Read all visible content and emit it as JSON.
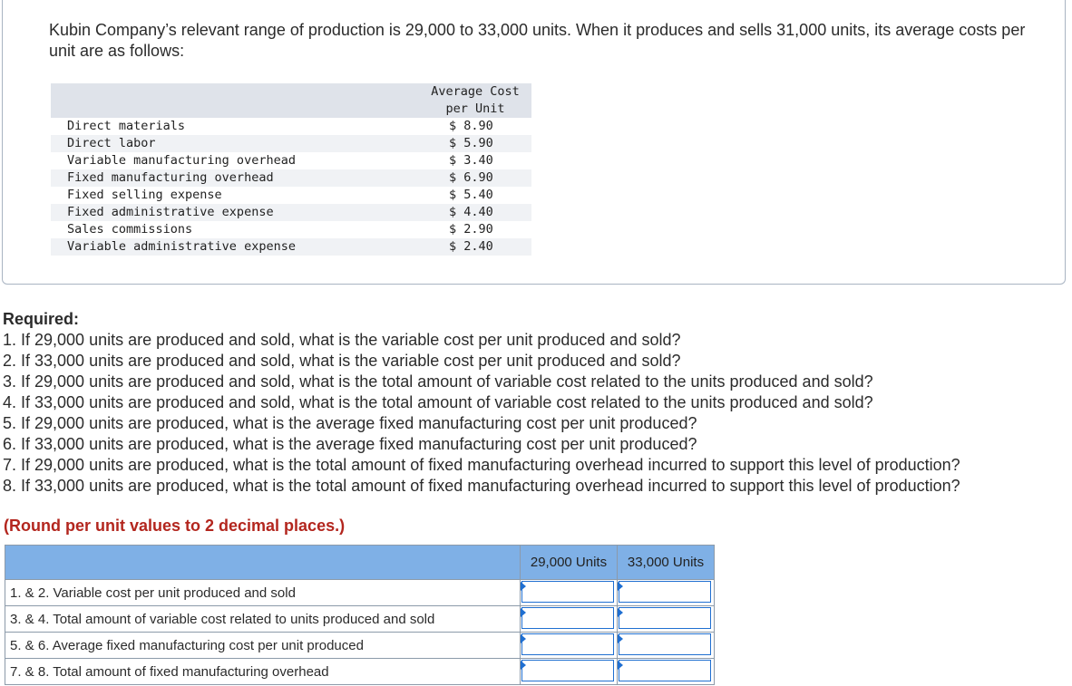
{
  "intro": "Kubin Company’s relevant range of production is 29,000 to 33,000 units. When it produces and sells 31,000 units, its average costs per unit are as follows:",
  "cost_table": {
    "header_line1": "Average Cost",
    "header_line2": "per Unit",
    "rows": [
      {
        "label": "Direct materials",
        "value": "$ 8.90"
      },
      {
        "label": "Direct labor",
        "value": "$ 5.90"
      },
      {
        "label": "Variable manufacturing overhead",
        "value": "$ 3.40"
      },
      {
        "label": "Fixed manufacturing overhead",
        "value": "$ 6.90"
      },
      {
        "label": "Fixed selling expense",
        "value": "$ 5.40"
      },
      {
        "label": "Fixed administrative expense",
        "value": "$ 4.40"
      },
      {
        "label": "Sales commissions",
        "value": "$ 2.90"
      },
      {
        "label": "Variable administrative expense",
        "value": "$ 2.40"
      }
    ]
  },
  "required": {
    "heading": "Required:",
    "items": [
      "1. If 29,000 units are produced and sold, what is the variable cost per unit produced and sold?",
      "2. If 33,000 units are produced and sold, what is the variable cost per unit produced and sold?",
      "3. If 29,000 units are produced and sold, what is the total amount of variable cost related to the units produced and sold?",
      "4. If 33,000 units are produced and sold, what is the total amount of variable cost related to the units produced and sold?",
      "5. If 29,000 units are produced, what is the average fixed manufacturing cost per unit produced?",
      "6. If 33,000 units are produced, what is the average fixed manufacturing cost per unit produced?",
      "7. If 29,000 units are produced, what is the total amount of fixed manufacturing overhead incurred to support this level of production?",
      "8. If 33,000 units are produced, what is the total amount of fixed manufacturing overhead incurred to support this level of production?"
    ]
  },
  "round_note": "(Round per unit values to 2 decimal places.)",
  "answer_table": {
    "col1": "29,000 Units",
    "col2": "33,000 Units",
    "rows": [
      {
        "label": "1. & 2. Variable cost per unit produced and sold",
        "v1": "",
        "v2": ""
      },
      {
        "label": "3. & 4. Total amount of variable cost related to units produced and sold",
        "v1": "",
        "v2": ""
      },
      {
        "label": "5. & 6. Average fixed manufacturing cost per unit produced",
        "v1": "",
        "v2": ""
      },
      {
        "label": "7. & 8. Total amount of fixed manufacturing overhead",
        "v1": "",
        "v2": ""
      }
    ]
  }
}
